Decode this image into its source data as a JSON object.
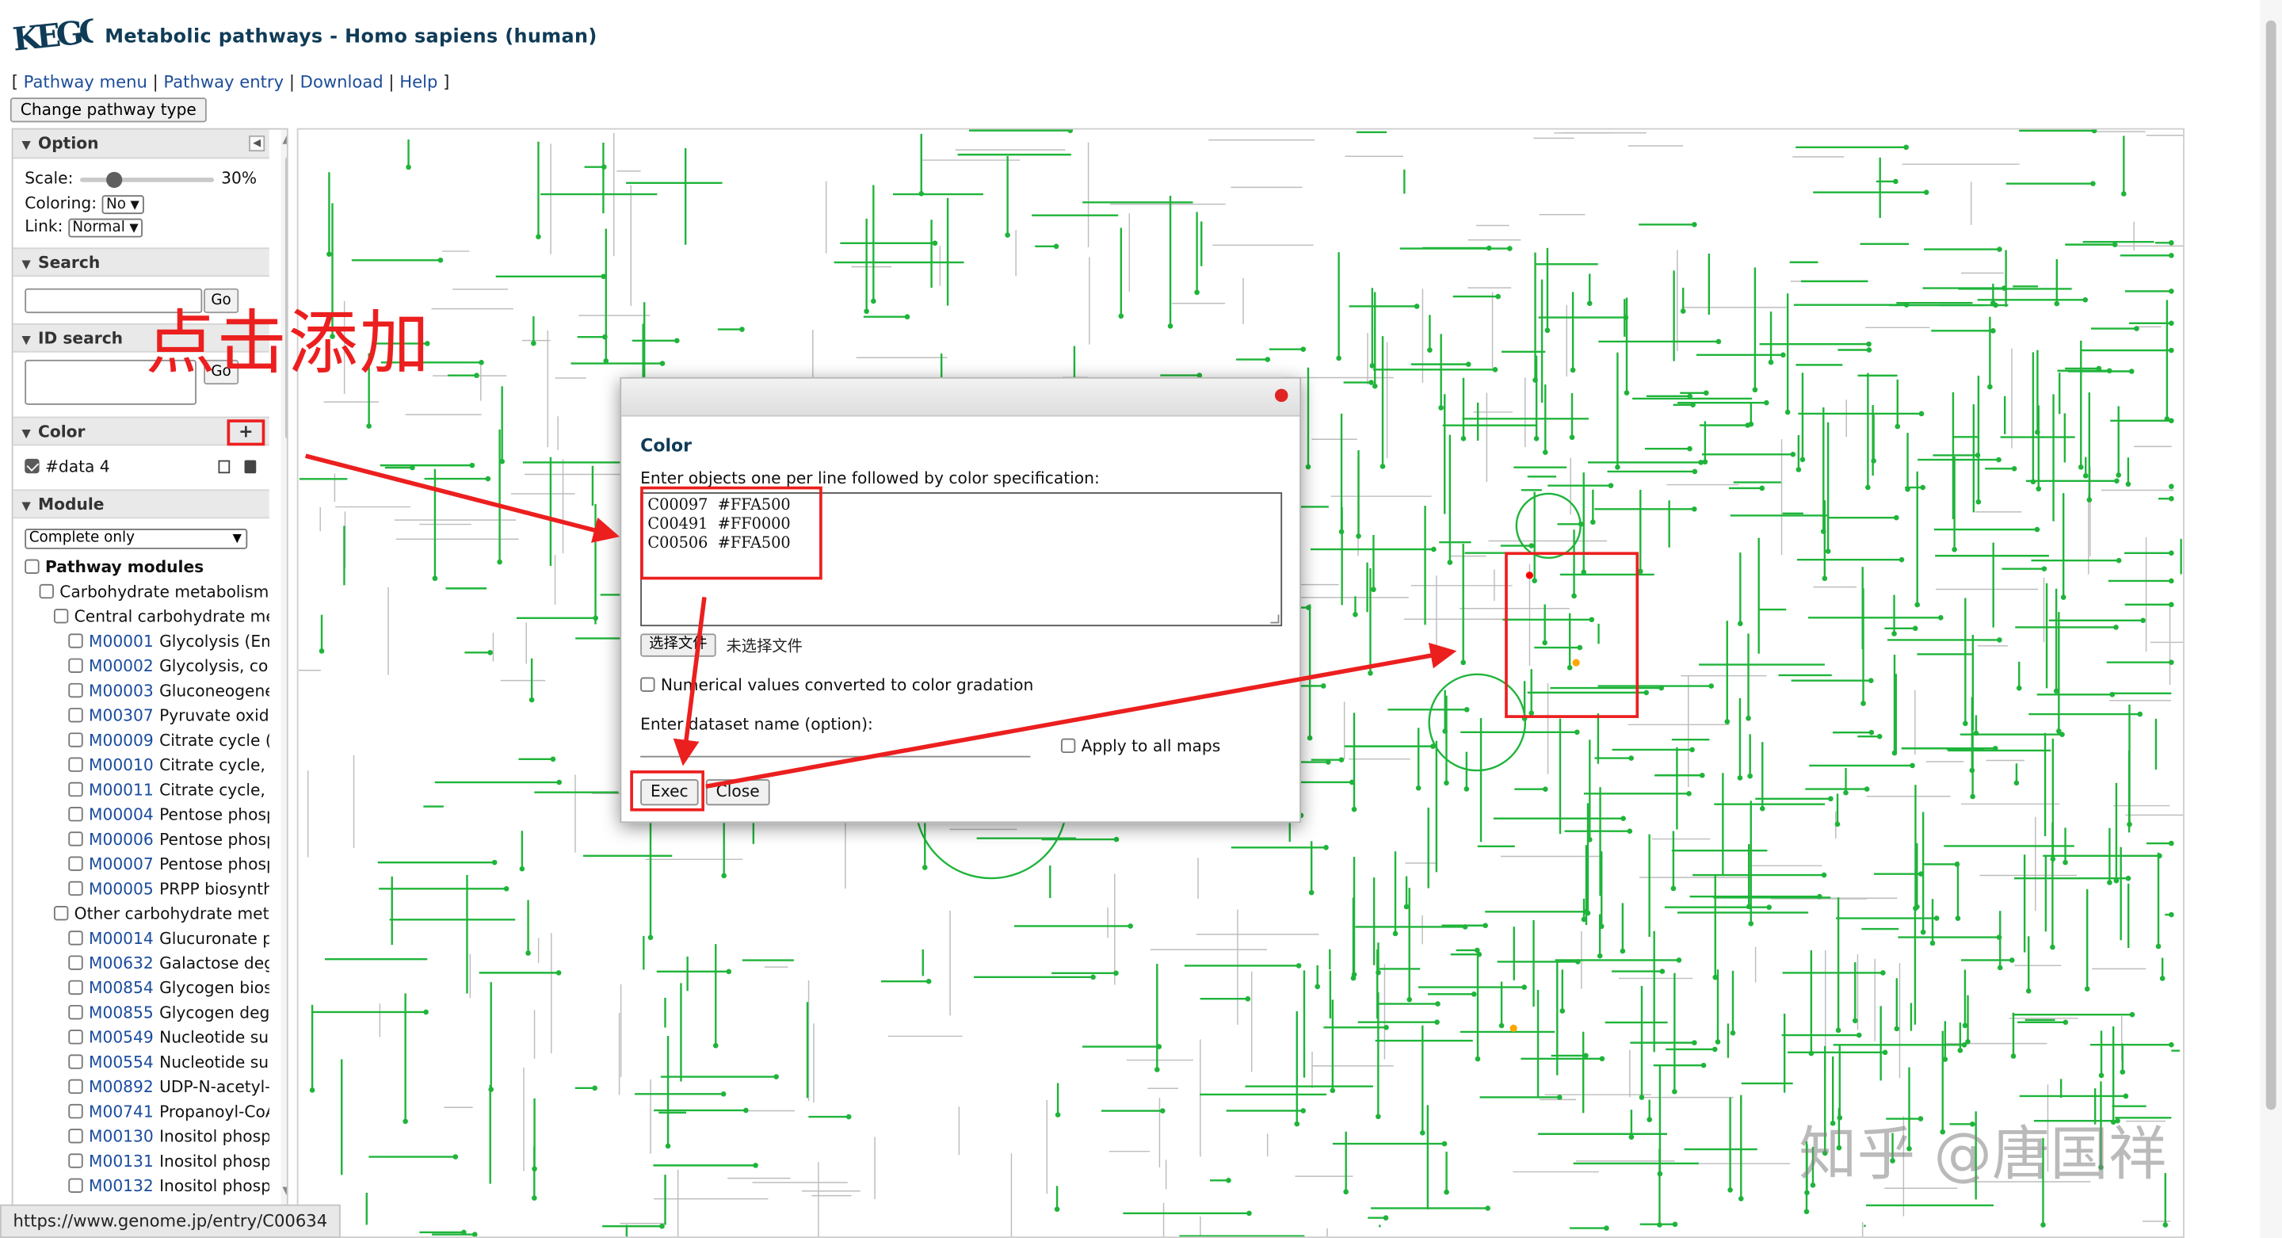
{
  "header": {
    "logo_text": "KEGG",
    "title": "Metabolic pathways - Homo sapiens (human)",
    "nav": [
      {
        "label": "Pathway menu"
      },
      {
        "label": "Pathway entry"
      },
      {
        "label": "Download"
      },
      {
        "label": "Help"
      }
    ],
    "nav_open": "[",
    "nav_close": "]",
    "nav_sep": "|",
    "change_button": "Change pathway type"
  },
  "panel": {
    "option": {
      "title": "Option",
      "scale_label": "Scale:",
      "scale_value": "30%",
      "scale_fraction": 0.3,
      "coloring_label": "Coloring:",
      "coloring_value": "No",
      "link_label": "Link:",
      "link_value": "Normal"
    },
    "search": {
      "title": "Search",
      "go": "Go"
    },
    "id_search": {
      "title": "ID search",
      "go": "Go"
    },
    "color": {
      "title": "Color",
      "add": "+",
      "dataset": "#data 4"
    },
    "module": {
      "title": "Module",
      "filter": "Complete only",
      "tree": [
        {
          "level": 0,
          "bold": true,
          "label": "Pathway modules"
        },
        {
          "level": 1,
          "label": "Carbohydrate metabolism"
        },
        {
          "level": 2,
          "label": "Central carbohydrate me"
        },
        {
          "level": 3,
          "id": "M00001",
          "label": "Glycolysis (Em"
        },
        {
          "level": 3,
          "id": "M00002",
          "label": "Glycolysis, cor"
        },
        {
          "level": 3,
          "id": "M00003",
          "label": "Gluconeogene"
        },
        {
          "level": 3,
          "id": "M00307",
          "label": "Pyruvate oxida"
        },
        {
          "level": 3,
          "id": "M00009",
          "label": "Citrate cycle ("
        },
        {
          "level": 3,
          "id": "M00010",
          "label": "Citrate cycle, f"
        },
        {
          "level": 3,
          "id": "M00011",
          "label": "Citrate cycle, s"
        },
        {
          "level": 3,
          "id": "M00004",
          "label": "Pentose phosp"
        },
        {
          "level": 3,
          "id": "M00006",
          "label": "Pentose phosp"
        },
        {
          "level": 3,
          "id": "M00007",
          "label": "Pentose phosp"
        },
        {
          "level": 3,
          "id": "M00005",
          "label": "PRPP biosynth"
        },
        {
          "level": 2,
          "label": "Other carbohydrate meta"
        },
        {
          "level": 3,
          "id": "M00014",
          "label": "Glucuronate p"
        },
        {
          "level": 3,
          "id": "M00632",
          "label": "Galactose deg"
        },
        {
          "level": 3,
          "id": "M00854",
          "label": "Glycogen bios"
        },
        {
          "level": 3,
          "id": "M00855",
          "label": "Glycogen degr"
        },
        {
          "level": 3,
          "id": "M00549",
          "label": "Nucleotide suç"
        },
        {
          "level": 3,
          "id": "M00554",
          "label": "Nucleotide suç"
        },
        {
          "level": 3,
          "id": "M00892",
          "label": "UDP-N-acetyl-"
        },
        {
          "level": 3,
          "id": "M00741",
          "label": "Propanoyl-CoA"
        },
        {
          "level": 3,
          "id": "M00130",
          "label": "Inositol phosp"
        },
        {
          "level": 3,
          "id": "M00131",
          "label": "Inositol phosp"
        },
        {
          "level": 3,
          "id": "M00132",
          "label": "Inositol phosp"
        }
      ]
    }
  },
  "dialog": {
    "heading": "Color",
    "prompt": "Enter objects one per line followed by color specification:",
    "lines": [
      "C00097  #FFA500",
      "C00491  #FF0000",
      "C00506  #FFA500"
    ],
    "file_button": "选择文件",
    "file_status": "未选择文件",
    "numeric_label": "Numerical values converted to color gradation",
    "dataset_label": "Enter dataset name (option):",
    "apply_label": "Apply to all maps",
    "exec": "Exec",
    "close": "Close"
  },
  "overlay": {
    "annotation": "点击添加",
    "watermark": "知乎 @唐国祥",
    "status_url": "https://www.genome.jp/entry/C00634"
  },
  "colors": {
    "pathway": "#1fb43a",
    "pathway_faint": "#bdbdbd",
    "annotation": "#ec1f1f",
    "highlight_orange": "#FFA500",
    "highlight_red": "#FF0000",
    "title": "#0f3b57",
    "link": "#1d4d9a"
  }
}
